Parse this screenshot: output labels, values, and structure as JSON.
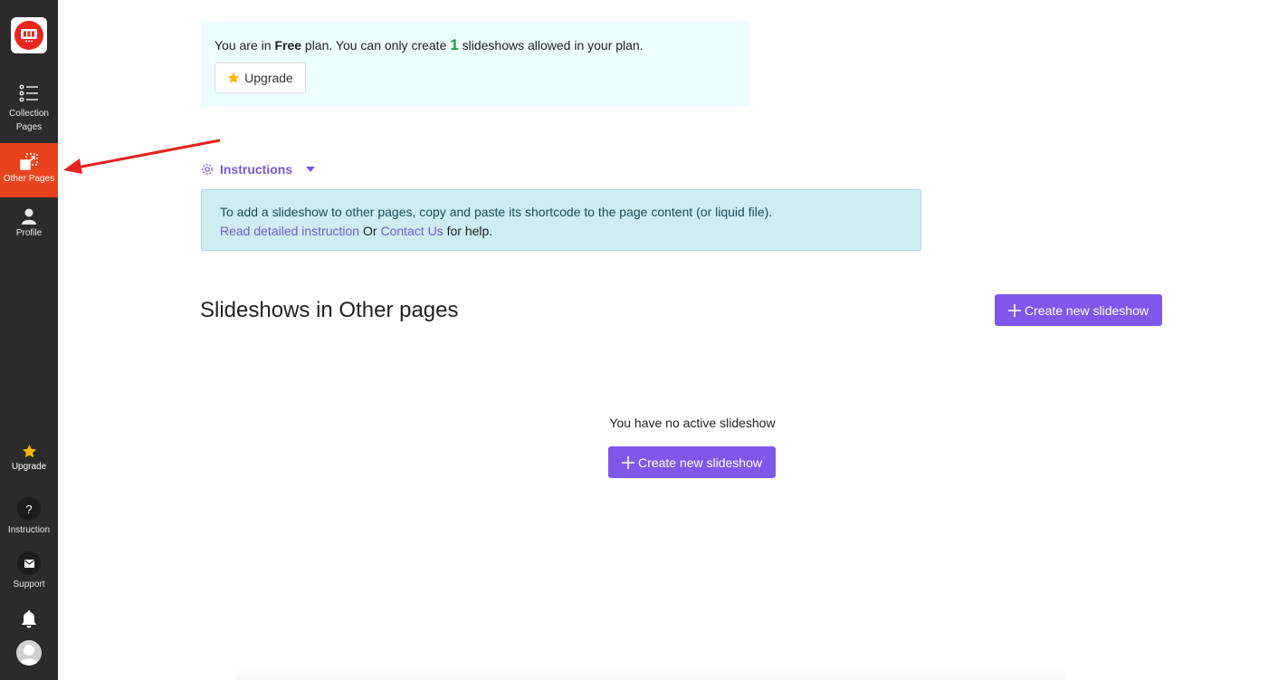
{
  "sidebar": {
    "items": [
      {
        "label_line1": "Collection",
        "label_line2": "Pages"
      },
      {
        "label": "Other Pages"
      },
      {
        "label": "Profile"
      },
      {
        "label": "Upgrade"
      },
      {
        "label": "Instruction"
      },
      {
        "label": "Support"
      }
    ],
    "accent_color": "#e8431c",
    "background_color": "#2b2b2b"
  },
  "plan": {
    "prefix": "You are in ",
    "plan_name": "Free",
    "middle": " plan. You can only create ",
    "count": "1",
    "suffix": " slideshows allowed in your plan.",
    "upgrade_label": "Upgrade"
  },
  "instructions": {
    "toggle_label": "Instructions",
    "text": "To add a slideshow to other pages, copy and paste its shortcode to the page content (or liquid file).",
    "link1": "Read detailed instruction",
    "or_text": " Or ",
    "link2": "Contact Us",
    "tail": " for help."
  },
  "section": {
    "title": "Slideshows in Other pages",
    "create_label": "Create new slideshow"
  },
  "empty_state": {
    "text": "You have no active slideshow",
    "create_label": "Create new slideshow"
  },
  "colors": {
    "primary": "#7e58ea",
    "link": "#7a57d1",
    "plan_box": "#ebfdfd",
    "instr_box": "#cdedf3"
  }
}
